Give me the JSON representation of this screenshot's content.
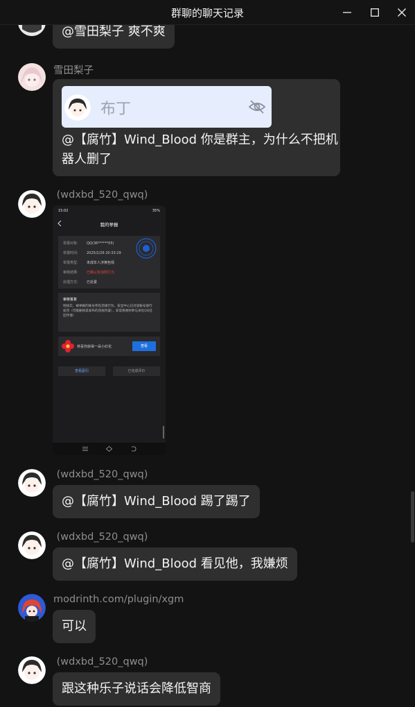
{
  "window": {
    "title": "群聊的聊天记录"
  },
  "messages": [
    {
      "id": "m0",
      "sender": "",
      "text": "@雪田梨子 爽不爽"
    },
    {
      "id": "m1",
      "sender": "雪田梨子",
      "mention_card": {
        "name": "布丁"
      },
      "text_line1": "@【腐竹】Wind_Blood 你是群主，为什么不把机",
      "text_line2": "器人删了"
    },
    {
      "id": "m2",
      "sender": " (wdxbd_520_qwq)",
      "image": {
        "status_time": "15:02",
        "status_right": "35%",
        "header": "我的举报",
        "rows": [
          {
            "label": "举报对象:",
            "value": "QQ(36******05)"
          },
          {
            "label": "举报时间:",
            "value": "2025/2/26 20:33:29"
          },
          {
            "label": "举报类型:",
            "value": "未成年人涉黄色情"
          },
          {
            "label": "审核结果:",
            "value": "已确认有违规行为"
          },
          {
            "label": "处理方式:",
            "value": "已处置"
          }
        ],
        "feedback_title": "审核答复",
        "feedback_text": "经核实，被举报的账号存在违规行为，安全中心已对该账号进行处罚（可能删除其发布的违规内容），非常感谢你参与净化QQ社区环境！",
        "flower_text": "恭喜你获得一朵小红花",
        "flower_button": "查看",
        "left_button": "查看副引",
        "right_button": "已完成评价"
      }
    },
    {
      "id": "m3",
      "sender": " (wdxbd_520_qwq)",
      "text": "@【腐竹】Wind_Blood 踢了踢了"
    },
    {
      "id": "m4",
      "sender": " (wdxbd_520_qwq)",
      "text": "@【腐竹】Wind_Blood 看见他，我嫌烦"
    },
    {
      "id": "m5",
      "sender": "modrinth.com/plugin/xgm",
      "text": "可以"
    },
    {
      "id": "m6",
      "sender": " (wdxbd_520_qwq)",
      "text": "跟这种乐子说话会降低智商"
    }
  ],
  "colors": {
    "background": "#131313",
    "bubble": "#2f2f2f",
    "nickname": "#8e8e8e",
    "mention_card": "#e6edfd",
    "report_red": "#e04040",
    "stamp_blue": "#1e5fd8"
  }
}
